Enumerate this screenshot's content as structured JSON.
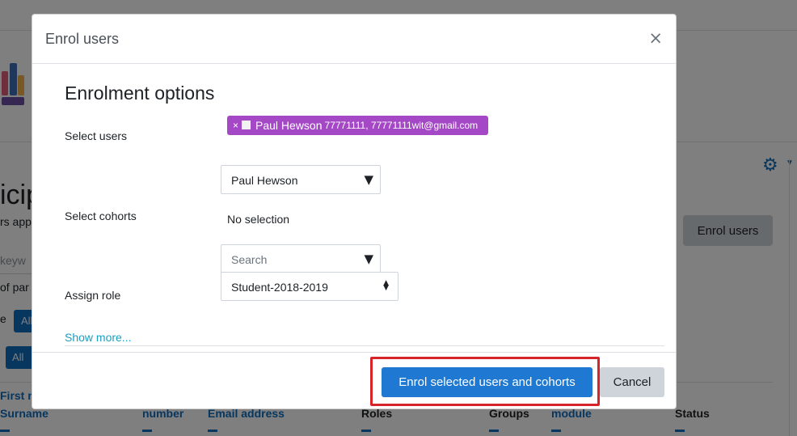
{
  "background": {
    "title_fragment": "icipa",
    "subtitle_fragment": "rs app",
    "enrol_button": "Enrol users",
    "keyword_placeholder": "keyw",
    "of_participants_fragment": "of par",
    "match_fragment": "e",
    "all_label_1": "All",
    "all_label_2": "All",
    "columns": {
      "first_name": "First n",
      "surname": "Surname",
      "id_number": "number",
      "email": "Email address",
      "roles": "Roles",
      "groups": "Groups",
      "module": "module",
      "status": "Status"
    }
  },
  "modal": {
    "title": "Enrol users",
    "close_symbol": "×",
    "section_title": "Enrolment options",
    "select_users_label": "Select users",
    "selected_user": {
      "remove_symbol": "×",
      "name": "Paul Hewson",
      "detail": "77771111, 77771111wit@gmail.com"
    },
    "user_search_value": "Paul Hewson",
    "select_cohorts_label": "Select cohorts",
    "cohorts_selection": "No selection",
    "cohort_search_placeholder": "Search",
    "assign_role_label": "Assign role",
    "role_value": "Student-2018-2019",
    "show_more": "Show more...",
    "primary_button": "Enrol selected users and cohorts",
    "cancel_button": "Cancel"
  },
  "colors": {
    "chip": "#a548c6",
    "primary": "#1f78d1",
    "highlight": "#d7232a",
    "link": "#1a9fc1"
  }
}
